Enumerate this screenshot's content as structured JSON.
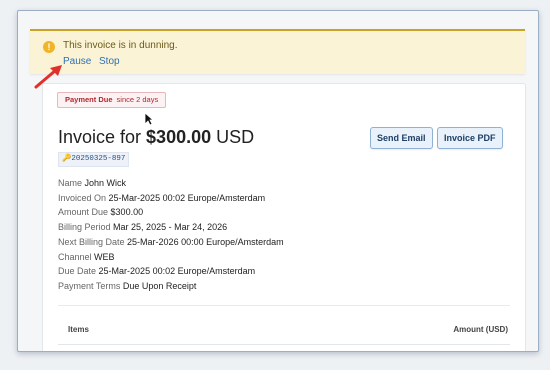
{
  "banner": {
    "message": "This invoice is in dunning.",
    "actions": [
      "Pause",
      "Stop"
    ]
  },
  "status": {
    "label": "Payment Due",
    "since": "since 2 days"
  },
  "invoice": {
    "title_prefix": "Invoice for ",
    "amount": "$300.00",
    "currency": " USD",
    "code": "20250325-897"
  },
  "buttons": {
    "send_email": "Send Email",
    "invoice_pdf": "Invoice PDF"
  },
  "details": [
    {
      "key": "Name",
      "value": "John Wick"
    },
    {
      "key": "Invoiced On",
      "value": "25-Mar-2025 00:02 Europe/Amsterdam"
    },
    {
      "key": "Amount Due",
      "value": "$300.00"
    },
    {
      "key": "Billing Period",
      "value": "Mar 25, 2025 - Mar 24, 2026"
    },
    {
      "key": "Next Billing Date",
      "value": "25-Mar-2026 00:00 Europe/Amsterdam"
    },
    {
      "key": "Channel",
      "value": "WEB"
    },
    {
      "key": "Due Date",
      "value": "25-Mar-2025 00:02 Europe/Amsterdam"
    },
    {
      "key": "Payment Terms",
      "value": "Due Upon Receipt"
    }
  ],
  "table": {
    "columns": [
      "Items",
      "Amount (USD)"
    ]
  },
  "colors": {
    "banner_bg": "#fbf3d5",
    "banner_border": "#c9a227",
    "link": "#2f6fb3",
    "badge_text": "#b0282f",
    "arrow": "#e0302a"
  },
  "icons": {
    "banner": "warning-icon",
    "code": "key-icon",
    "annotation": "red-arrow-icon",
    "pointer": "mouse-cursor-icon"
  }
}
